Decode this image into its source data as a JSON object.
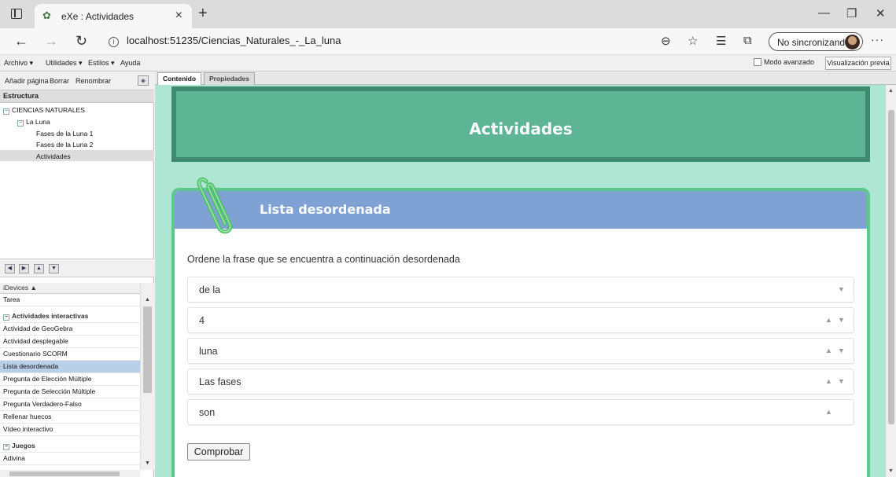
{
  "browser": {
    "tab_title": "eXe : Actividades",
    "url": "localhost:51235/Ciencias_Naturales_-_La_luna",
    "sync_label": "No sincronizando"
  },
  "menu": {
    "archivo": "Archivo ▾",
    "utilidades": "Utilidades ▾",
    "estilos": "Estilos ▾",
    "ayuda": "Ayuda",
    "modo_avanzado": "Modo avanzado",
    "vista_previa": "Visualización previa"
  },
  "left_toolbar": {
    "add_page": "Añadir página",
    "delete": "Borrar",
    "rename": "Renombrar"
  },
  "structure": {
    "heading": "Estructura",
    "root": "CIENCIAS NATURALES",
    "child": "La Luna",
    "pages": [
      "Fases de la Luna 1",
      "Fases de la Luna 2",
      "Actividades"
    ]
  },
  "idevices": {
    "heading": "iDevices ▲",
    "items": [
      {
        "label": "Tarea",
        "type": "item"
      },
      {
        "label": "Actividades interactivas",
        "type": "group"
      },
      {
        "label": "Actividad de GeoGebra",
        "type": "item"
      },
      {
        "label": "Actividad desplegable",
        "type": "item"
      },
      {
        "label": "Cuestionario SCORM",
        "type": "item"
      },
      {
        "label": "Lista desordenada",
        "type": "selected"
      },
      {
        "label": "Pregunta de Elección Múltiple",
        "type": "item"
      },
      {
        "label": "Pregunta de Selección Múltiple",
        "type": "item"
      },
      {
        "label": "Pregunta Verdadero-Falso",
        "type": "item"
      },
      {
        "label": "Rellenar huecos",
        "type": "item"
      },
      {
        "label": "Vídeo interactivo",
        "type": "item"
      },
      {
        "label": "Juegos",
        "type": "group"
      },
      {
        "label": "Adivina",
        "type": "item"
      }
    ]
  },
  "content_tabs": [
    "Contenido",
    "Propiedades"
  ],
  "page": {
    "title": "Actividades",
    "idevice_title": "Lista desordenada",
    "instructions": "Ordene la frase que se encuentra a continuación desordenada",
    "items": [
      {
        "text": "de la",
        "up": false,
        "down": true
      },
      {
        "text": "4",
        "up": true,
        "down": true
      },
      {
        "text": "luna",
        "up": true,
        "down": true
      },
      {
        "text": "Las fases",
        "up": true,
        "down": true
      },
      {
        "text": "son",
        "up": true,
        "down": false
      }
    ],
    "check_button": "Comprobar"
  },
  "colors": {
    "content_bg": "#aee6d3",
    "header_bg": "#5db596",
    "header_border": "#3e8a6d",
    "card_border": "#5ec78e",
    "card_header": "#7fa1d4",
    "selected_item": "#b8cfe8"
  }
}
